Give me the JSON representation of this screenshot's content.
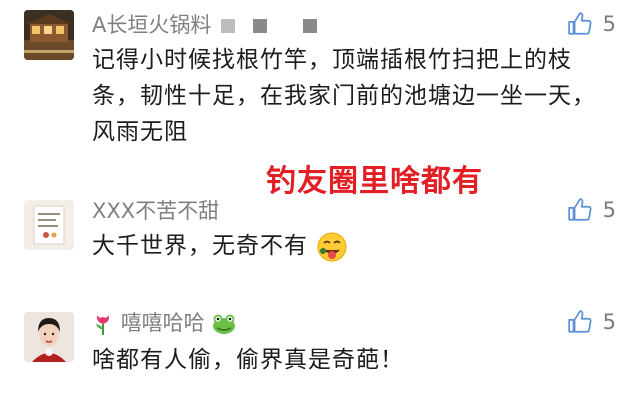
{
  "comments": [
    {
      "username": "A长垣火锅料",
      "text": "记得小时候找根竹竿，顶端插根竹扫把上的枝条，韧性十足，在我家门前的池塘边一坐一天，风雨无阻",
      "likes": "5",
      "avatar_icon": "restaurant-photo-avatar"
    },
    {
      "username": "XXX不苦不甜",
      "text": "大千世界，无奇不有",
      "likes": "5",
      "avatar_icon": "note-card-avatar",
      "emoji_icon": "face-with-tongue-emoji"
    },
    {
      "username": "嘻嘻哈哈",
      "text": "啥都有人偷，偷界真是奇葩！",
      "likes": "5",
      "avatar_icon": "woman-portrait-avatar",
      "prefix_icon": "tulip-icon",
      "suffix_icon": "frog-icon"
    }
  ],
  "overlay_title": "钓友圈里啥都有",
  "colors": {
    "username": "#7f7f7f",
    "text": "#1c1c1c",
    "overlay": "#e31f26",
    "like": "#7b7b7b"
  }
}
